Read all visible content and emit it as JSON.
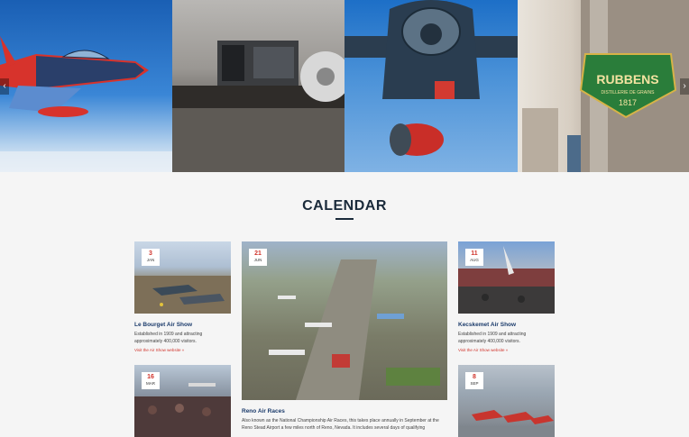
{
  "slider": {
    "prev_label": "‹",
    "next_label": "›",
    "slides": [
      {
        "name": "aerobatic-jet"
      },
      {
        "name": "hangar-crowd"
      },
      {
        "name": "military-aircraft"
      },
      {
        "name": "rubbens-sponsor"
      }
    ],
    "sponsor_logo_text": [
      "RUBBENS",
      "DISTILLERIE DE GRAINS",
      "1817"
    ]
  },
  "calendar": {
    "title": "CALENDAR",
    "events": [
      {
        "day": "3",
        "month": "JAN",
        "title": "Le Bourget Air Show",
        "desc": "Established in 1909 and attracting approximately 400,000 visitors.",
        "link": "Visit the Air Show website »"
      },
      {
        "day": "21",
        "month": "JUN",
        "title": "Reno Air Races",
        "desc": "Also known as the National Championship Air Races, this takes place annually in September at the Reno Stead Airport a few miles north of Reno, Nevada. It includes several days of qualifying",
        "link": ""
      },
      {
        "day": "11",
        "month": "AUG",
        "title": "Kecskemet Air Show",
        "desc": "Established in 1909 and attracting approximately 400,000 visitors.",
        "link": "Visit the Air Show website »"
      },
      {
        "day": "16",
        "month": "MAR",
        "title": "",
        "desc": "",
        "link": ""
      },
      {
        "day": "8",
        "month": "SEP",
        "title": "",
        "desc": "",
        "link": ""
      }
    ]
  },
  "colors": {
    "accent": "#d0342c",
    "title": "#1b3b6b",
    "heading": "#1a2a3a",
    "background": "#f5f5f5"
  }
}
